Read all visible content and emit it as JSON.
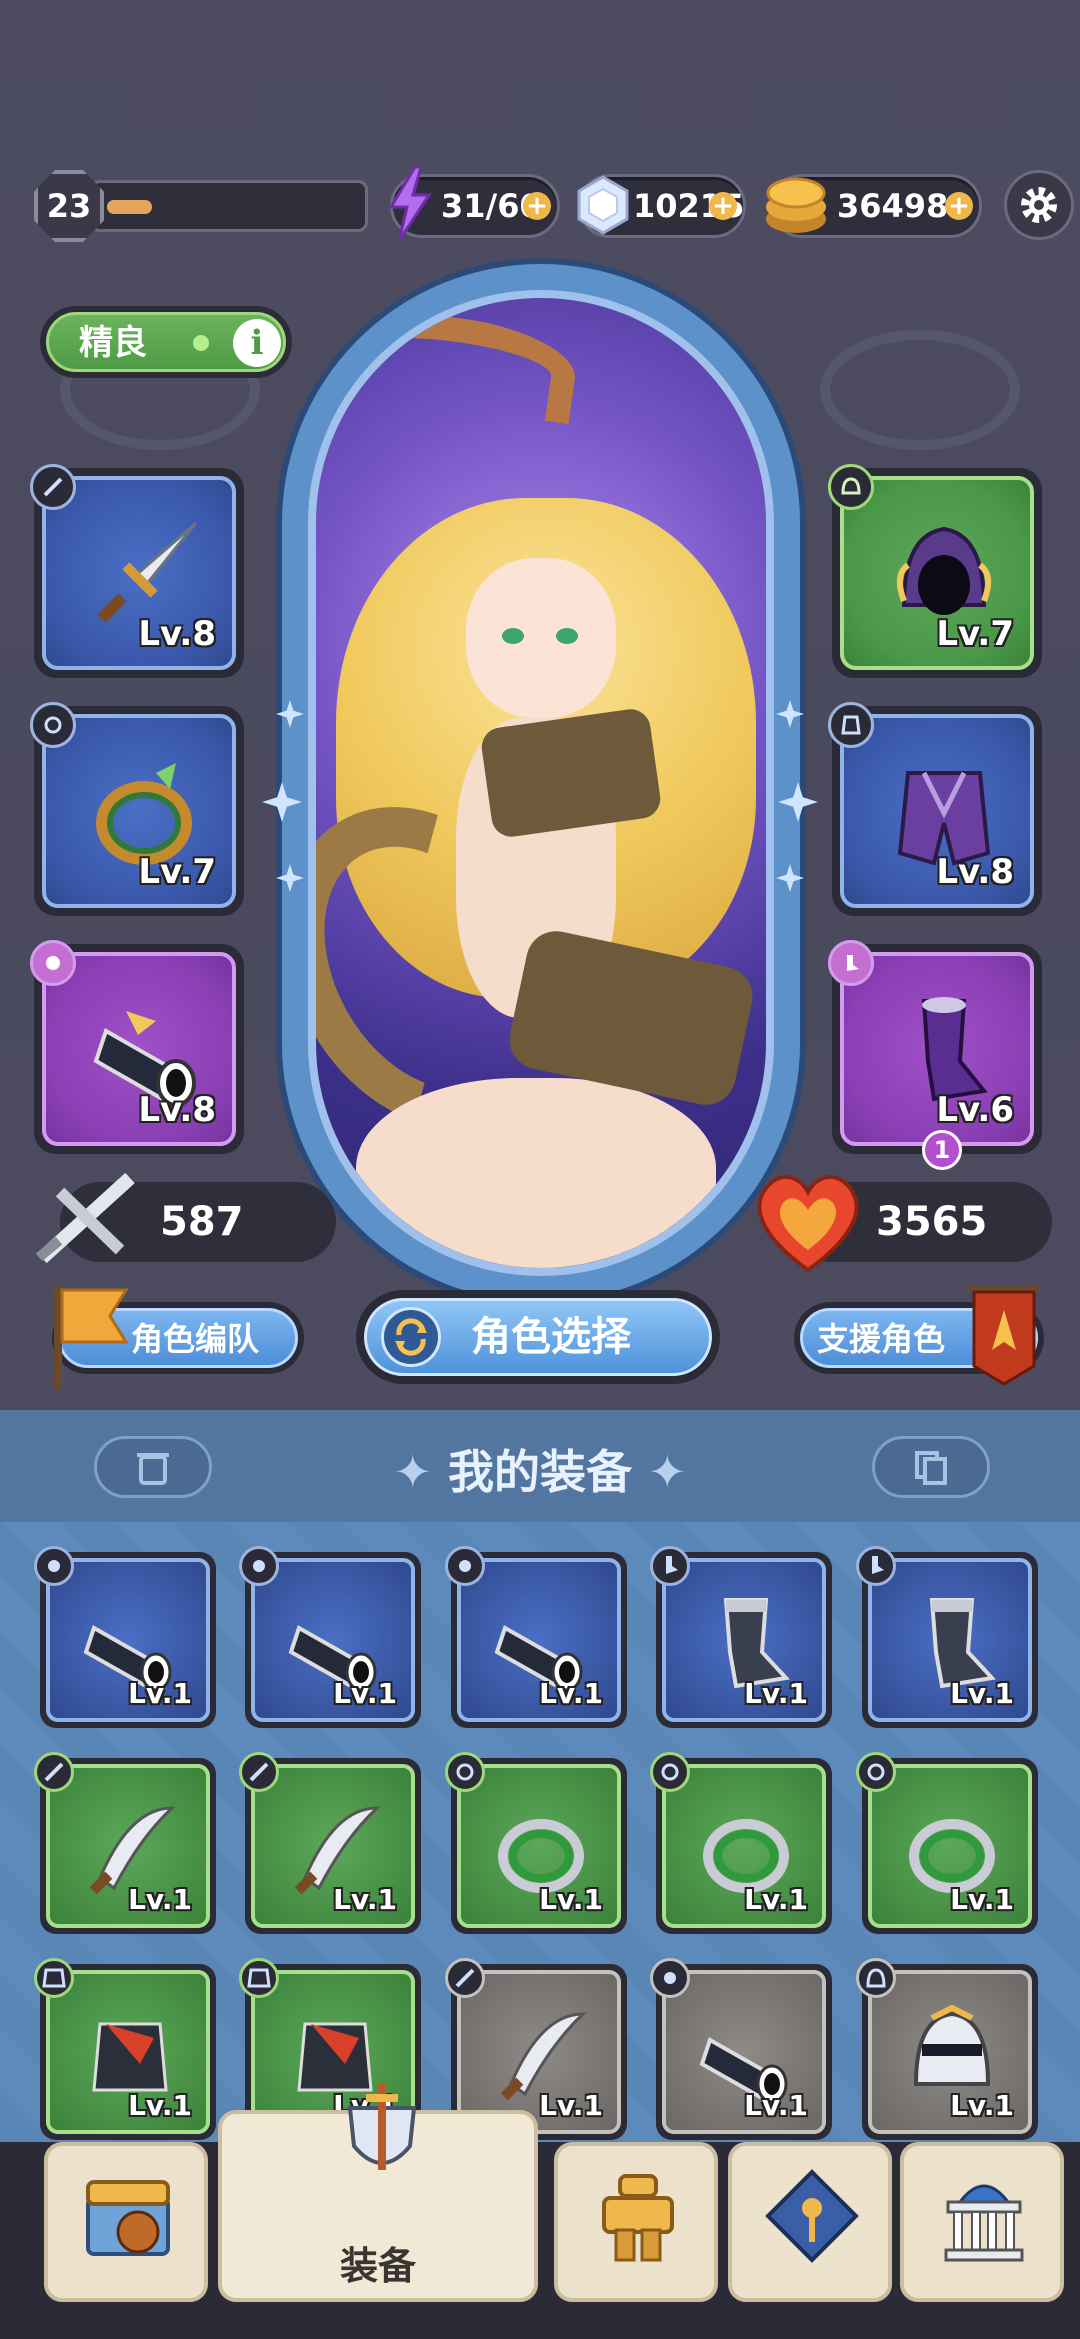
{
  "player": {
    "level": "23",
    "xp_fraction": 0.18
  },
  "resources": {
    "energy": "31/60",
    "gems": "10215",
    "gold": "364983"
  },
  "character": {
    "grade": "精良",
    "attack": "587",
    "hp": "3565"
  },
  "left_slots": [
    {
      "type": "weapon",
      "level": "Lv.8",
      "rarity": "blue"
    },
    {
      "type": "ring",
      "level": "Lv.7",
      "rarity": "blue"
    },
    {
      "type": "gloves",
      "level": "Lv.8",
      "rarity": "purple"
    }
  ],
  "right_slots": [
    {
      "type": "helmet",
      "level": "Lv.7",
      "rarity": "green"
    },
    {
      "type": "armor",
      "level": "Lv.8",
      "rarity": "blue"
    },
    {
      "type": "boots",
      "level": "Lv.6",
      "rarity": "purple",
      "badge": "1"
    }
  ],
  "buttons": {
    "team": "角色编队",
    "select": "角色选择",
    "support": "支援角色"
  },
  "equipment_section": {
    "title": "我的装备",
    "items": [
      {
        "type": "gloves",
        "rarity": "blue",
        "level": "Lv.1"
      },
      {
        "type": "gloves",
        "rarity": "blue",
        "level": "Lv.1"
      },
      {
        "type": "gloves",
        "rarity": "blue",
        "level": "Lv.1"
      },
      {
        "type": "boots",
        "rarity": "blue",
        "level": "Lv.1"
      },
      {
        "type": "boots",
        "rarity": "blue",
        "level": "Lv.1"
      },
      {
        "type": "weapon",
        "rarity": "green",
        "level": "Lv.1"
      },
      {
        "type": "weapon",
        "rarity": "green",
        "level": "Lv.1"
      },
      {
        "type": "ring",
        "rarity": "green",
        "level": "Lv.1"
      },
      {
        "type": "ring",
        "rarity": "green",
        "level": "Lv.1"
      },
      {
        "type": "ring",
        "rarity": "green",
        "level": "Lv.1"
      },
      {
        "type": "armor",
        "rarity": "green",
        "level": "Lv.1"
      },
      {
        "type": "armor",
        "rarity": "green",
        "level": "Lv.1"
      },
      {
        "type": "weapon",
        "rarity": "gray",
        "level": "Lv.1"
      },
      {
        "type": "gloves",
        "rarity": "gray",
        "level": "Lv.1"
      },
      {
        "type": "helmet",
        "rarity": "gray",
        "level": "Lv.1"
      }
    ]
  },
  "nav": {
    "active_label": "装备"
  }
}
